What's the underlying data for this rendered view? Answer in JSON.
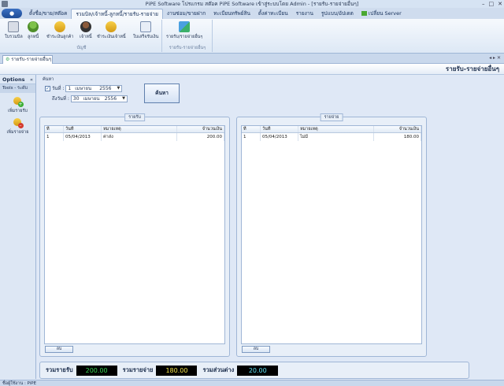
{
  "window": {
    "title": "PiPE Software โปรแกรม สต๊อค PiPE Software เข้าสู่ระบบโดย Admin - [รายรับ-รายจ่ายอื่นๆ]",
    "controls": [
      "–",
      "□",
      "✕"
    ]
  },
  "ribbon": {
    "app_button": "●",
    "tabs": [
      {
        "label": "ตั้งชื่อ/ขาย/สต๊อค"
      },
      {
        "label": "รวมบิล/เจ้าหนี้-ลูกหนี้/รายรับ-รายจ่าย"
      },
      {
        "label": "งานซ่อม/ขายฝาก"
      },
      {
        "label": "ทะเบียนทรัพย์สิน"
      },
      {
        "label": "ตั้งค่าทะเบียน"
      },
      {
        "label": "รายงาน"
      },
      {
        "label": "รูปแบบ/อัปเดต"
      },
      {
        "label": "เปลี่ยน Server"
      }
    ],
    "groups": [
      {
        "title": "บัญชี"
      },
      {
        "title": "รายรับ-รายจ่ายอื่นๆ"
      }
    ],
    "buttons": [
      {
        "label": "ใบรวมบิล"
      },
      {
        "label": "ลูกหนี้"
      },
      {
        "label": "ชำระเงินลูกค้า"
      },
      {
        "label": "เจ้าหนี้"
      },
      {
        "label": "ชำระเงินเจ้าหนี้"
      },
      {
        "label": "ใบเสร็จรับเงิน"
      },
      {
        "label": "รายรับ/รายจ่ายอื่นๆ"
      }
    ]
  },
  "doc_tab": {
    "label": "รายรับ-รายจ่ายอื่นๆ",
    "controls": "◂ ▸ ✕"
  },
  "page_header": "รายรับ-รายจ่ายอื่นๆ",
  "left_panel": {
    "title": "Options",
    "close": "«",
    "section": "Tools - ระดับ",
    "items": [
      {
        "label": "เพิ่มรายรับ"
      },
      {
        "label": "เพิ่มรายจ่าย"
      }
    ]
  },
  "search": {
    "label": "ค้นหา",
    "from_label": "วันที่ :",
    "from": {
      "day": "1",
      "month": "เมษายน",
      "year": "2556"
    },
    "to_label": "ถึงวันที่ :",
    "to": {
      "day": "30",
      "month": "เมษายน",
      "year": "2556"
    },
    "button": "ค้นหา",
    "checked": true
  },
  "income": {
    "title": "รายรับ",
    "columns": [
      "ที่",
      "วันที่",
      "หมายเหตุ",
      "จำนวนเงิน"
    ],
    "rows": [
      [
        "1",
        "05/04/2013",
        "ค่าส่ง",
        "200.00"
      ]
    ],
    "delete_button": "ลบ"
  },
  "expense": {
    "title": "รายจ่าย",
    "columns": [
      "ที่",
      "วันที่",
      "หมายเหตุ",
      "จำนวนเงิน"
    ],
    "rows": [
      [
        "1",
        "05/04/2013",
        "ไม่มี",
        "180.00"
      ]
    ],
    "delete_button": "ลบ"
  },
  "totals": {
    "income_label": "รวมรายรับ",
    "income_value": "200.00",
    "expense_label": "รวมรายจ่าย",
    "expense_value": "180.00",
    "diff_label": "รวมส่วนต่าง",
    "diff_value": "20.00"
  },
  "status": "ชื่อผู้ใช้งาน : PiPE",
  "colors": {
    "accent": "#1e4b96",
    "income_value": "#39d353",
    "expense_value": "#f2e34b",
    "diff_value": "#5fe3f5"
  }
}
